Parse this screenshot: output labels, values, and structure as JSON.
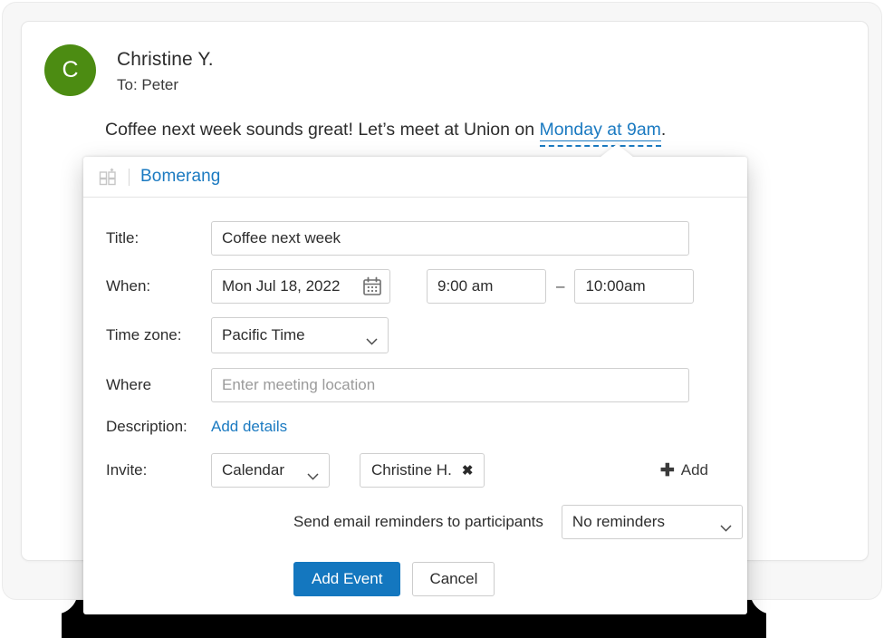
{
  "email": {
    "avatar_initial": "C",
    "avatar_color": "#4c8c12",
    "sender_name": "Christine Y.",
    "recipient_line": "To: Peter",
    "body_before": "Coffee next week sounds great! Let’s meet at Union on ",
    "body_link": "Monday at 9am",
    "body_after": "."
  },
  "popup": {
    "brand_name": "Bomerang",
    "brand_color": "#1b7ac1",
    "fields": {
      "title_label": "Title:",
      "title_value": "Coffee next week",
      "when_label": "When:",
      "date_value": "Mon Jul  18, 2022",
      "start_time": "9:00 am",
      "time_separator": "–",
      "end_time": "10:00am",
      "timezone_label": "Time zone:",
      "timezone_value": "Pacific Time",
      "where_label": "Where",
      "where_placeholder": "Enter meeting location",
      "description_label": "Description:",
      "description_link": "Add details",
      "invite_label": "Invite:",
      "invite_source": "Calendar",
      "invitee_name": "Christine H.",
      "invitee_remove": "✖",
      "add_label": "Add",
      "add_plus": "✚",
      "reminder_text": "Send email reminders to participants",
      "reminder_value": "No reminders"
    },
    "actions": {
      "primary_label": "Add Event",
      "primary_color": "#1477bf",
      "secondary_label": "Cancel"
    }
  }
}
